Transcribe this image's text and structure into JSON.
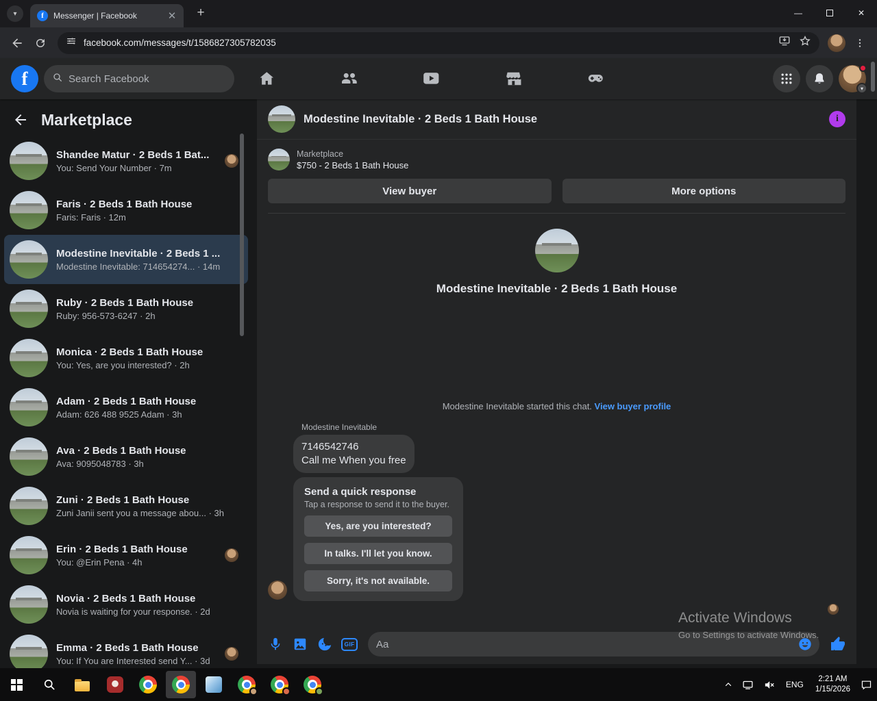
{
  "browser": {
    "tab_title": "Messenger | Facebook",
    "url": "facebook.com/messages/t/1586827305782035"
  },
  "fb_header": {
    "search_placeholder": "Search Facebook"
  },
  "sidebar": {
    "title": "Marketplace",
    "conversations": [
      {
        "name": "Shandee Matur · 2 Beds 1 Bat...",
        "preview": "You: Send Your Number",
        "time": "7m",
        "badge": true,
        "selected": false
      },
      {
        "name": "Faris · 2 Beds 1 Bath House",
        "preview": "Faris: Faris",
        "time": "12m",
        "badge": false,
        "selected": false
      },
      {
        "name": "Modestine Inevitable · 2 Beds 1 ...",
        "preview": "Modestine Inevitable: 714654274...",
        "time": "14m",
        "badge": false,
        "selected": true
      },
      {
        "name": "Ruby · 2 Beds 1 Bath House",
        "preview": "Ruby: 956-573-6247",
        "time": "2h",
        "badge": false,
        "selected": false
      },
      {
        "name": "Monica · 2 Beds 1 Bath House",
        "preview": "You: Yes, are you interested?",
        "time": "2h",
        "badge": false,
        "selected": false
      },
      {
        "name": "Adam · 2 Beds 1 Bath House",
        "preview": "Adam: 626 488 9525 Adam",
        "time": "3h",
        "badge": false,
        "selected": false
      },
      {
        "name": "Ava · 2 Beds 1 Bath House",
        "preview": "Ava: 9095048783",
        "time": "3h",
        "badge": false,
        "selected": false
      },
      {
        "name": "Zuni · 2 Beds 1 Bath House",
        "preview": "Zuni Janii sent you a message abou...",
        "time": "3h",
        "badge": false,
        "selected": false
      },
      {
        "name": "Erin · 2 Beds 1 Bath House",
        "preview": "You: @Erin Pena",
        "time": "4h",
        "badge": true,
        "selected": false
      },
      {
        "name": "Novia · 2 Beds 1 Bath House",
        "preview": "Novia is waiting for your response.",
        "time": "2d",
        "badge": false,
        "selected": false
      },
      {
        "name": "Emma · 2 Beds 1 Bath House",
        "preview": "You: If You are Interested send Y...",
        "time": "3d",
        "badge": true,
        "selected": false
      }
    ]
  },
  "chat": {
    "title": "Modestine Inevitable · 2 Beds 1 Bath House",
    "marketplace_label": "Marketplace",
    "listing_line": "$750 - 2 Beds 1 Bath House",
    "view_buyer_button": "View buyer",
    "more_options_button": "More options",
    "started_text": "Modestine Inevitable started this chat.",
    "view_buyer_profile_link": "View buyer profile",
    "sender_name": "Modestine Inevitable",
    "message_line1": "7146542746",
    "message_line2": "Call me When you free",
    "quick_response": {
      "title": "Send a quick response",
      "subtitle": "Tap a response to send it to the buyer.",
      "options": [
        "Yes, are you interested?",
        "In talks. I'll let you know.",
        "Sorry, it's not available."
      ]
    },
    "composer": {
      "placeholder": "Aa",
      "gif_label": "GIF"
    }
  },
  "watermark": {
    "line1": "Activate Windows",
    "line2": "Go to Settings to activate Windows."
  },
  "taskbar": {
    "language": "ENG",
    "time": "2:21 AM",
    "date": "1/15/2026"
  }
}
